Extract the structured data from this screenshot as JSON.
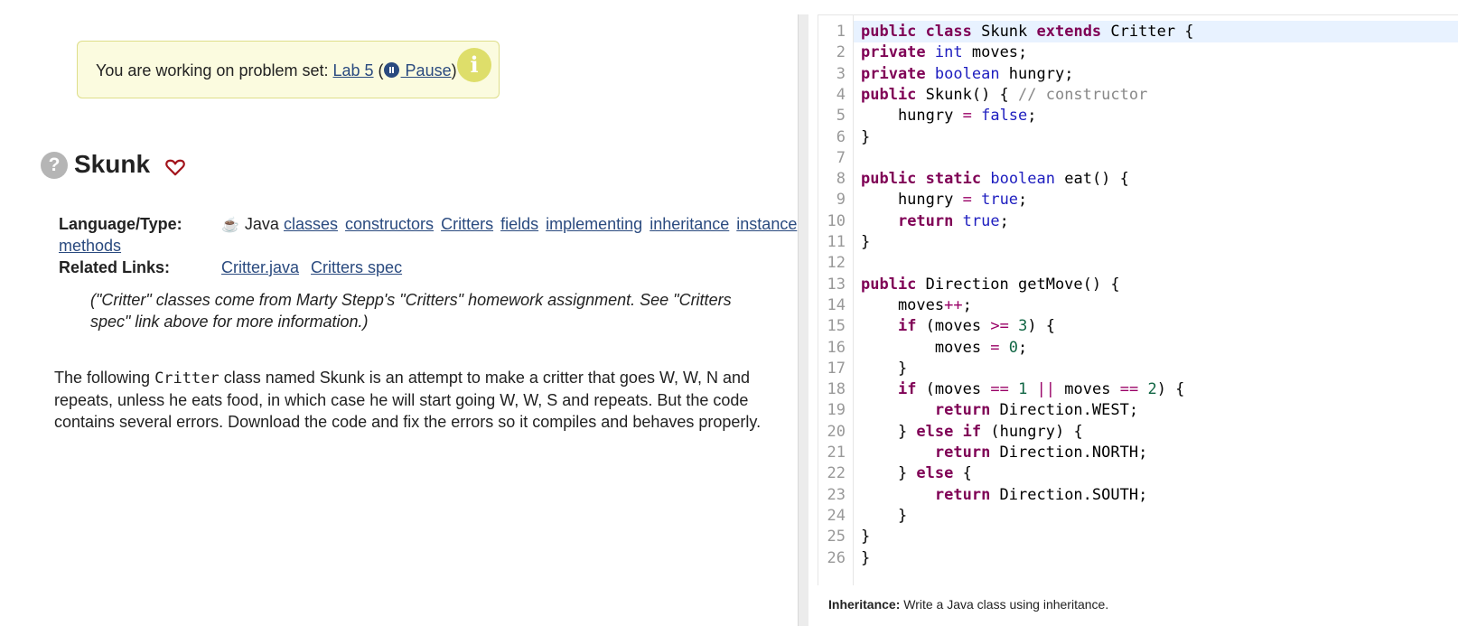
{
  "notice": {
    "prefix": "You are working on problem set: ",
    "set_link": "Lab 5",
    "paren_open": " (",
    "pause_label": " Pause",
    "paren_close": ")",
    "info_icon": "i"
  },
  "problem": {
    "title": "Skunk",
    "help_icon": "?",
    "language_label": "Language/Type:",
    "language": "Java",
    "tags": [
      "classes",
      "constructors",
      "Critters",
      "fields",
      "implementing",
      "inheritance",
      "instance"
    ],
    "tag_wrap": "methods",
    "related_label": "Related Links:",
    "related_links": [
      "Critter.java",
      "Critters spec"
    ],
    "note": "(\"Critter\" classes come from Marty Stepp's \"Critters\" homework assignment. See \"Critters spec\" link above for more information.)",
    "desc_before": "The following ",
    "desc_code": "Critter",
    "desc_after": " class named Skunk is an attempt to make a critter that goes W, W, N and repeats, unless he eats food, in which case he will start going W, W, S and repeats. But the code contains several errors. Download the code and fix the errors so it compiles and behaves properly."
  },
  "editor": {
    "lines": [
      "public class Skunk extends Critter {",
      "private int moves;",
      "private boolean hungry;",
      "public Skunk() { // constructor",
      "    hungry = false;",
      "}",
      "",
      "public static boolean eat() {",
      "    hungry = true;",
      "    return true;",
      "}",
      "",
      "public Direction getMove() {",
      "    moves++;",
      "    if (moves >= 3) {",
      "        moves = 0;",
      "    }",
      "    if (moves == 1 || moves == 2) {",
      "        return Direction.WEST;",
      "    } else if (hungry) {",
      "        return Direction.NORTH;",
      "    } else {",
      "        return Direction.SOUTH;",
      "    }",
      "}",
      "}"
    ]
  },
  "footer": {
    "label": "Inheritance:",
    "text": " Write a Java class using inheritance."
  },
  "colors": {
    "link": "#2a4a7f",
    "notice_bg": "#fbfbdf",
    "keyword": "#7f0055",
    "type": "#1d1dbf"
  }
}
